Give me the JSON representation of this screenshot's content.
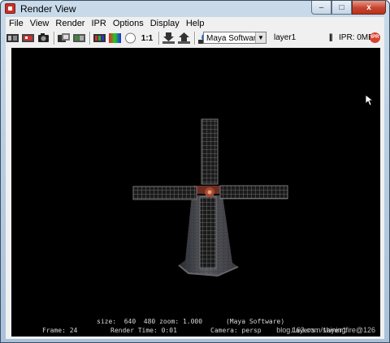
{
  "window": {
    "title": "Render View",
    "minimize": "–",
    "maximize": "□",
    "close": "x"
  },
  "menu": [
    "File",
    "View",
    "Render",
    "IPR",
    "Options",
    "Display",
    "Help"
  ],
  "toolbar": {
    "ratio_label": "1:1",
    "renderer": "Maya Software",
    "layer": "layer1",
    "pause": "||",
    "ipr_memory": "IPR: 0MB",
    "ipr_badge": "IPR",
    "icons": [
      "redo-render-icon",
      "render-region-icon",
      "snapshot-icon",
      "ipr-render-icon",
      "refresh-ipr-icon",
      "render-diagnostics-icon",
      "color-channels-icon",
      "alpha-channel-icon",
      "save-image-icon",
      "keep-image-icon",
      "remove-image-icon",
      "render-settings-icon"
    ]
  },
  "render_info": {
    "size_line": "size:  640  480 zoom: 1.000      (Maya Software)",
    "frame": "Frame: 24",
    "render_time": "Render Time: 0:01",
    "camera": "Camera: persp",
    "layers": "Layers: layer1"
  },
  "watermark": "blog.163.com/shiningfire@126"
}
